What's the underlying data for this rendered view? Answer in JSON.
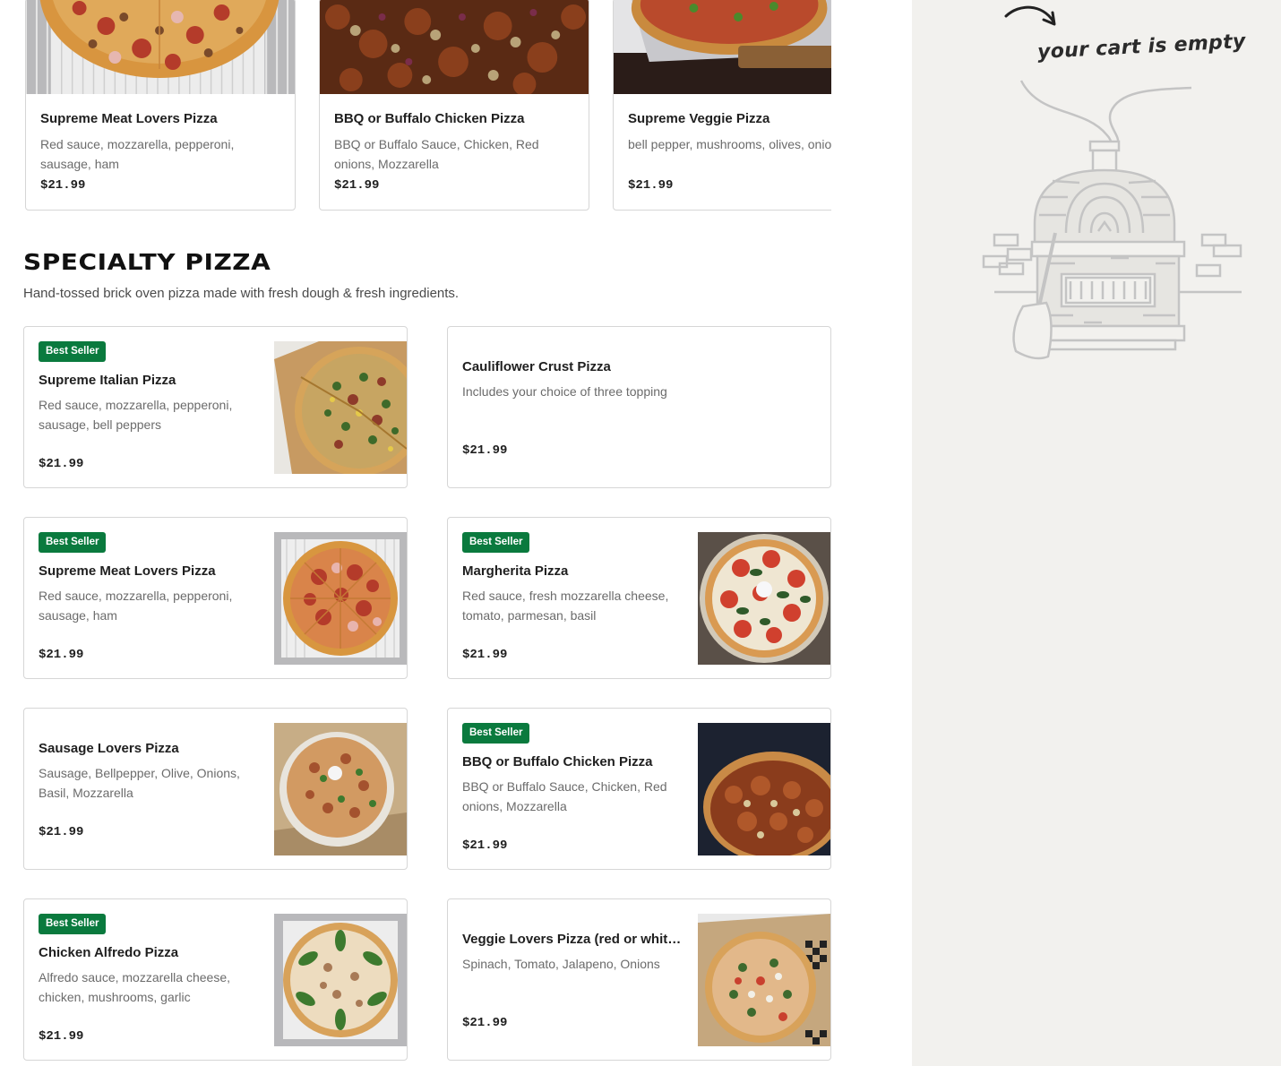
{
  "top_carousel": [
    {
      "name": "Supreme Meat Lovers Pizza",
      "description": "Red sauce, mozzarella, pepperoni, sausage, ham",
      "price": "$21.99",
      "image": "pizza-meat-photo"
    },
    {
      "name": "BBQ or Buffalo Chicken Pizza",
      "description": "BBQ or Buffalo Sauce, Chicken, Red onions, Mozzarella",
      "price": "$21.99",
      "image": "pizza-bbq-photo"
    },
    {
      "name": "Supreme Veggie Pizza",
      "description": "bell pepper, mushrooms, olives, onio",
      "price": "$21.99",
      "image": "pizza-veggie-photo"
    }
  ],
  "section": {
    "title": "SPECIALTY PIZZA",
    "subtitle": "Hand-tossed brick oven pizza made with fresh dough & fresh ingredients."
  },
  "items": [
    {
      "badge": "Best Seller",
      "name": "Supreme Italian Pizza",
      "description": "Red sauce, mozzarella, pepperoni, sausage, bell peppers",
      "price": "$21.99"
    },
    {
      "badge": "",
      "name": "Cauliflower Crust Pizza",
      "description": "Includes your choice of three topping",
      "price": "$21.99"
    },
    {
      "badge": "Best Seller",
      "name": "Supreme Meat Lovers Pizza",
      "description": "Red sauce, mozzarella, pepperoni, sausage, ham",
      "price": "$21.99"
    },
    {
      "badge": "Best Seller",
      "name": "Margherita Pizza",
      "description": "Red sauce, fresh mozzarella cheese, tomato, parmesan, basil",
      "price": "$21.99"
    },
    {
      "badge": "",
      "name": "Sausage Lovers Pizza",
      "description": "Sausage, Bellpepper, Olive, Onions, Basil, Mozzarella",
      "price": "$21.99"
    },
    {
      "badge": "Best Seller",
      "name": "BBQ or Buffalo Chicken Pizza",
      "description": "BBQ or Buffalo Sauce, Chicken, Red onions, Mozzarella",
      "price": "$21.99"
    },
    {
      "badge": "Best Seller",
      "name": "Chicken Alfredo Pizza",
      "description": "Alfredo sauce, mozzarella cheese, chicken, mushrooms, garlic",
      "price": "$21.99"
    },
    {
      "badge": "",
      "name": "Veggie Lovers Pizza (red or whit…",
      "description": "Spinach, Tomato, Jalapeno, Onions",
      "price": "$21.99"
    }
  ],
  "cart": {
    "empty_text": "your cart is empty",
    "illustration": "brick-oven-icon"
  },
  "colors": {
    "badge": "#0a7a3e",
    "cart_background": "#f2f1ee",
    "card_border": "#d6d6d6"
  }
}
